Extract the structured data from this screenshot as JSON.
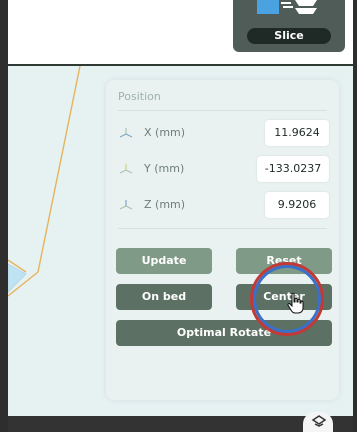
{
  "slice": {
    "button_label": "Slice"
  },
  "position_panel": {
    "title": "Position",
    "axes": [
      {
        "label": "X (mm)",
        "value": "11.9624"
      },
      {
        "label": "Y (mm)",
        "value": "-133.0237"
      },
      {
        "label": "Z (mm)",
        "value": "9.9206"
      }
    ],
    "buttons": {
      "update": "Update",
      "reset": "Reset",
      "on_bed": "On bed",
      "center": "Center",
      "optimal_rotate": "Optimal Rotate"
    }
  },
  "colors": {
    "primary_button": "#7f9a87",
    "secondary_button": "#5c7064",
    "panel_bg": "#e9f2f1",
    "viewport_bg": "#e6f1f2",
    "slice_bg": "#4f5c58"
  },
  "icons": {
    "slice": "slice-icon",
    "axis": "axis-icon",
    "cursor": "hand-cursor-icon",
    "bottom": "view-icon"
  }
}
